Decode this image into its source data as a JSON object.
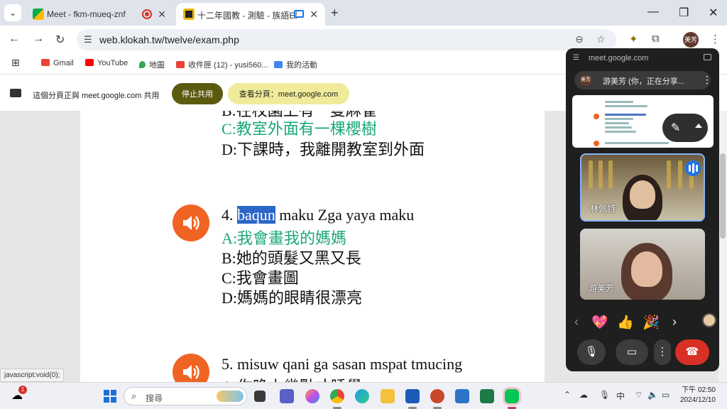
{
  "tabs": {
    "search_glyph": "⌄",
    "inactive_title": "Meet - fkm-mueq-znf",
    "active_title": "十二年國教 - 測驗 - 族語E樂園",
    "close_glyph": "✕",
    "newtab_glyph": "+"
  },
  "window_controls": {
    "minimize": "—",
    "restore": "❐",
    "close": "✕"
  },
  "toolbar": {
    "back": "←",
    "forward": "→",
    "reload": "↻",
    "url": "web.klokah.tw/twelve/exam.php",
    "zoom_glyph": "⊖",
    "star_glyph": "☆",
    "ext_glyph": "⧉",
    "more_glyph": "⋮",
    "avatar_label": "美芳"
  },
  "bookmarks": {
    "apps_glyph": "⊞",
    "items": [
      "Gmail",
      "YouTube",
      "地圖",
      "收件匣 (12) - yusi560...",
      "我的活動"
    ]
  },
  "share_banner": {
    "message": "這個分頁正與 meet.google.com 共用",
    "stop_label": "停止共用",
    "view_label": "查看分頁：meet.google.com"
  },
  "exam": {
    "top_partial": "B:在校園上有一隻麻雀",
    "q3_c": "C:教室外面有一棵櫻樹",
    "q3_d": "D:下課時，我離開教室到外面",
    "q4_num": "4.",
    "q4_highlight": "baqun",
    "q4_rest": "maku Zga yaya maku",
    "q4_a": "A:我會畫我的媽媽",
    "q4_b": "B:她的頭髮又黑又長",
    "q4_c": "C:我會畫圖",
    "q4_d": "D:媽媽的眼睛很漂亮",
    "q5_text": "5. misuw qani ga sasan mspat tmucing",
    "q5_a_partial": "A:你晚上幾點才睡覺"
  },
  "status_url": "javascript:void(0);",
  "meet": {
    "url": "meet.google.com",
    "sharing_avatar": "美芳",
    "sharing_text": "游美芳 (你，正在分享...",
    "more_glyph": "⋮",
    "pen_glyph": "✎",
    "participant1": "林佩詩",
    "participant2": "游美芳",
    "reactions": [
      "💖",
      "👍",
      "🎉"
    ],
    "prev_glyph": "‹",
    "next_glyph": "›",
    "mic_glyph": "🎙",
    "cam_glyph": "▭",
    "opt_glyph": "⋮",
    "end_glyph": "☎"
  },
  "taskbar": {
    "weather_badge": "1",
    "search_placeholder": "搜尋",
    "tray_chevron": "⌃",
    "ime": "中",
    "time": "下午 02:50",
    "date": "2024/12/10"
  }
}
